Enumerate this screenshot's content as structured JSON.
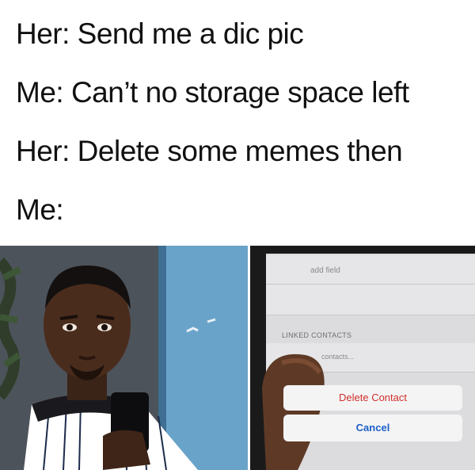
{
  "caption": {
    "line1": "Her: Send me a dic pic",
    "line2": "Me: Can’t no storage space left",
    "line3": "Her: Delete some memes then",
    "line4": "Me:"
  },
  "phone": {
    "add_field": "add field",
    "linked_contacts_header": "LINKED CONTACTS",
    "contacts_link": "contacts...",
    "delete_contact": "Delete Contact",
    "cancel": "Cancel"
  },
  "colors": {
    "caption_text": "#111111",
    "delete_red": "#d0302a",
    "cancel_blue": "#1d5fc8"
  }
}
